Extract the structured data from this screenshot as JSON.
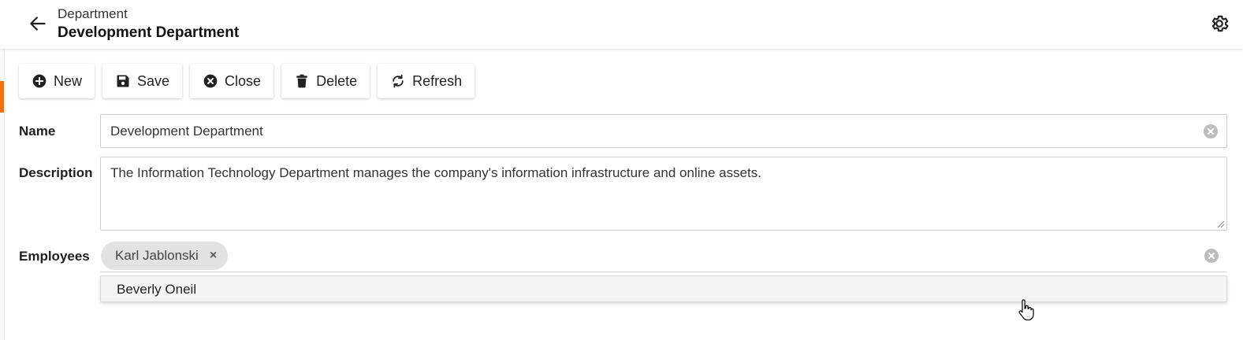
{
  "header": {
    "subtitle": "Department",
    "title": "Development Department"
  },
  "toolbar": {
    "new_label": "New",
    "save_label": "Save",
    "close_label": "Close",
    "delete_label": "Delete",
    "refresh_label": "Refresh"
  },
  "form": {
    "name_label": "Name",
    "name_value": "Development Department",
    "description_label": "Description",
    "description_value": "The Information Technology Department manages the company's information infrastructure and online assets.",
    "employees_label": "Employees",
    "employees_selected": [
      "Karl Jablonski"
    ],
    "employees_options": [
      "Beverly Oneil"
    ]
  },
  "colors": {
    "accent": "#f2700d"
  }
}
